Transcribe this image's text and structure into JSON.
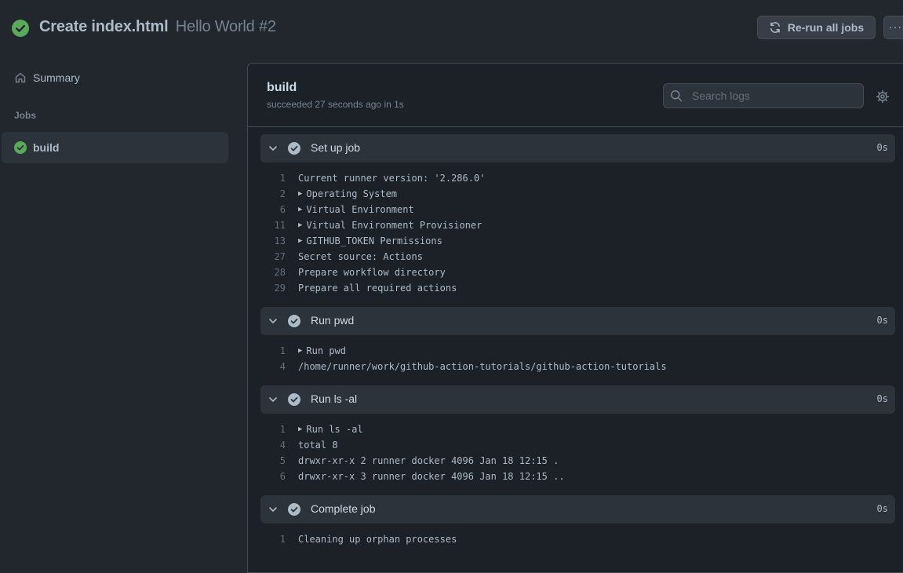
{
  "header": {
    "title": "Create index.html",
    "subtitle": "Hello World #2",
    "rerun_label": "Re-run all jobs",
    "more_label": "···",
    "status_icon": "check-circle-fill-icon",
    "status_color": "#57ab5a"
  },
  "sidebar": {
    "summary_label": "Summary",
    "jobs_heading": "Jobs",
    "jobs": [
      {
        "label": "build"
      }
    ]
  },
  "job": {
    "title": "build",
    "meta": "succeeded 27 seconds ago in 1s",
    "search_placeholder": "Search logs"
  },
  "steps": [
    {
      "name": "Set up job",
      "duration": "0s",
      "lines": [
        {
          "num": "1",
          "text": "Current runner version: '2.286.0'"
        },
        {
          "num": "2",
          "text": "Operating System",
          "collapsible": true
        },
        {
          "num": "6",
          "text": "Virtual Environment",
          "collapsible": true
        },
        {
          "num": "11",
          "text": "Virtual Environment Provisioner",
          "collapsible": true
        },
        {
          "num": "13",
          "text": "GITHUB_TOKEN Permissions",
          "collapsible": true
        },
        {
          "num": "27",
          "text": "Secret source: Actions"
        },
        {
          "num": "28",
          "text": "Prepare workflow directory"
        },
        {
          "num": "29",
          "text": "Prepare all required actions"
        }
      ]
    },
    {
      "name": "Run pwd",
      "duration": "0s",
      "lines": [
        {
          "num": "1",
          "text": "Run pwd",
          "collapsible": true
        },
        {
          "num": "4",
          "text": "/home/runner/work/github-action-tutorials/github-action-tutorials"
        }
      ]
    },
    {
      "name": "Run ls -al",
      "duration": "0s",
      "lines": [
        {
          "num": "1",
          "text": "Run ls -al",
          "collapsible": true
        },
        {
          "num": "4",
          "text": "total 8"
        },
        {
          "num": "5",
          "text": "drwxr-xr-x 2 runner docker 4096 Jan 18 12:15 ."
        },
        {
          "num": "6",
          "text": "drwxr-xr-x 3 runner docker 4096 Jan 18 12:15 .."
        }
      ]
    },
    {
      "name": "Complete job",
      "duration": "0s",
      "lines": [
        {
          "num": "1",
          "text": "Cleaning up orphan processes"
        }
      ]
    }
  ]
}
